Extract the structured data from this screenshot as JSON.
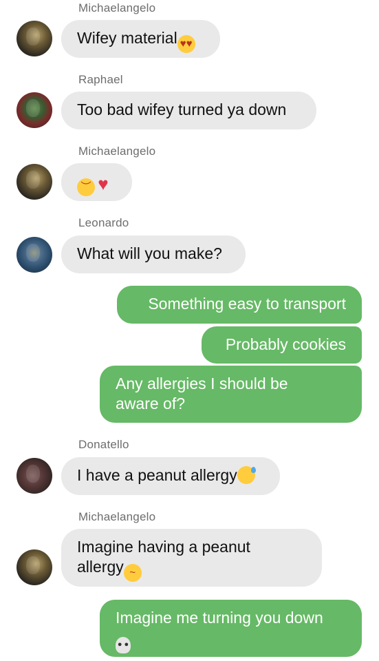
{
  "messages": [
    {
      "sender": "Michaelangelo",
      "text": "Wifey material",
      "emoji": "😍"
    },
    {
      "sender": "Raphael",
      "text": "Too bad wifey turned ya down"
    },
    {
      "sender": "Michaelangelo",
      "text": "",
      "emoji": "😞💔"
    },
    {
      "sender": "Leonardo",
      "text": "What will you make?"
    },
    {
      "text": "Something easy to transport"
    },
    {
      "text": "Probably cookies"
    },
    {
      "text_line1": "Any allergies I should be",
      "text_line2": "aware of?"
    },
    {
      "sender": "Donatello",
      "text": "I have a peanut allergy",
      "emoji": "😅"
    },
    {
      "sender": "Michaelangelo",
      "text_line1": "Imagine having a peanut",
      "text_line2": "allergy",
      "emoji": "🤧"
    },
    {
      "text": "Imagine me turning you down",
      "emoji": "💀"
    }
  ],
  "icons": {
    "heart_eyes": "heart-eyes-emoji",
    "sad_broken_heart": "disappointed-broken-heart-emoji",
    "sweat_smile": "sweat-smile-emoji",
    "sneeze": "sneezing-emoji",
    "skull": "skull-emoji"
  },
  "colors": {
    "incoming_bubble": "#e9e9e9",
    "outgoing_bubble": "#66b966",
    "sender_name": "#6d6d6d"
  }
}
